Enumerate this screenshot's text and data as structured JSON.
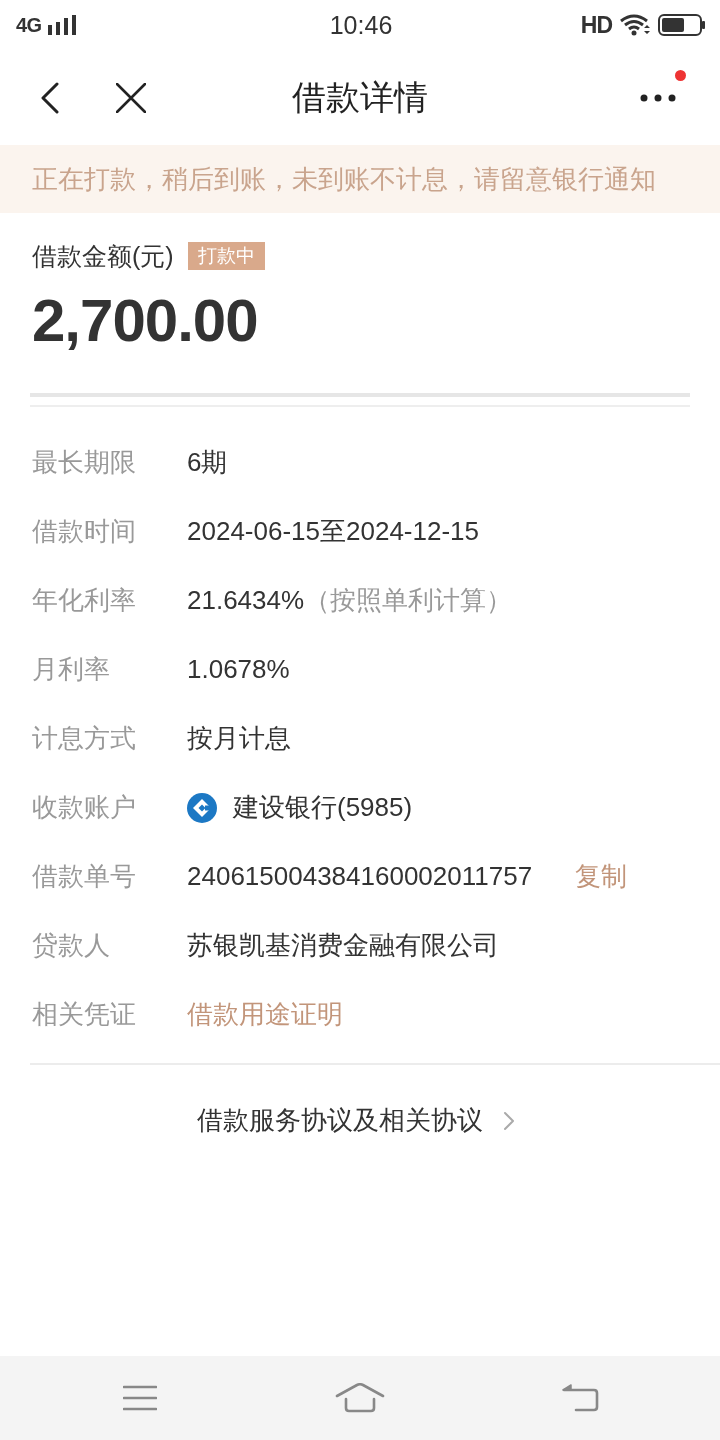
{
  "status_bar": {
    "network": "4G",
    "time": "10:46",
    "hd": "HD"
  },
  "nav": {
    "title": "借款详情",
    "notification_dot": true
  },
  "notice": "正在打款，稍后到账，未到账不计息，请留意银行通知",
  "amount": {
    "label": "借款金额(元)",
    "status": "打款中",
    "value": "2,700.00"
  },
  "details": [
    {
      "kind": "text",
      "label": "最长期限",
      "value": "6期"
    },
    {
      "kind": "text",
      "label": "借款时间",
      "value": "2024-06-15至2024-12-15"
    },
    {
      "kind": "note",
      "label": "年化利率",
      "value": "21.6434%",
      "note": "（按照单利计算）"
    },
    {
      "kind": "text",
      "label": "月利率",
      "value": "1.0678%"
    },
    {
      "kind": "text",
      "label": "计息方式",
      "value": "按月计息"
    },
    {
      "kind": "bank",
      "label": "收款账户",
      "value": "建设银行(5985)"
    },
    {
      "kind": "copy",
      "label": "借款单号",
      "value": "240615004384160002011757",
      "action": "复制"
    },
    {
      "kind": "text",
      "label": "贷款人",
      "value": "苏银凯基消费金融有限公司"
    },
    {
      "kind": "link",
      "label": "相关凭证",
      "value": "借款用途证明"
    }
  ],
  "agreement_link": "借款服务协议及相关协议"
}
